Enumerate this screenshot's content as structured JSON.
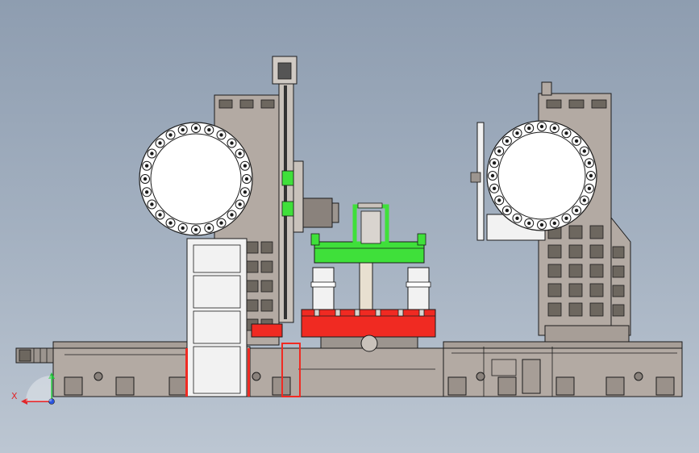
{
  "viewport": {
    "background_top": "#8e9db0",
    "background_bottom": "#bcc6d2"
  },
  "colors": {
    "casting": "#b3aaa3",
    "casting_dark": "#8a827c",
    "outline": "#1b1b1b",
    "window": "#6d675f",
    "fixture_green": "#3fe03a",
    "table_red": "#f02a22",
    "tool_white": "#ffffff",
    "column_white": "#f2f2f2",
    "axis_x": "#e0262a",
    "axis_y": "#22c03a",
    "axis_z": "#2b55e0"
  },
  "axis_triad": {
    "x_label": "X",
    "y_label": "Y",
    "z_label": "Z"
  },
  "components": {
    "left_tool_magazine_pockets": 24,
    "right_tool_magazine_pockets": 24,
    "left_column_window_rows": 6,
    "right_column_window_rows": 6
  }
}
